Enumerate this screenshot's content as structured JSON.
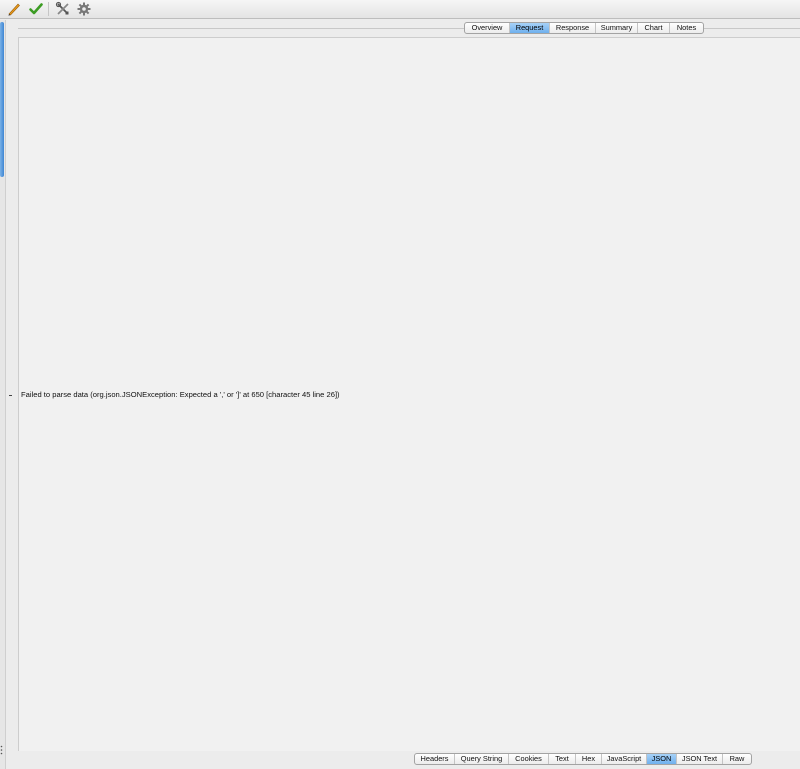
{
  "toolbar": {
    "buttons": [
      {
        "name": "pencil-icon",
        "color": "#e89a1c"
      },
      {
        "name": "checkmark-icon",
        "color": "#3c9c23"
      },
      {
        "name": "tools-icon",
        "color": "#555555"
      },
      {
        "name": "gear-icon",
        "color": "#777777"
      }
    ]
  },
  "top_tabs": {
    "items": [
      "Overview",
      "Request",
      "Response",
      "Summary",
      "Chart",
      "Notes"
    ],
    "active": "Request"
  },
  "body": {
    "error_message": "Failed to parse data (org.json.JSONException: Expected a ',' or ']' at 650 [character 45 line 26])"
  },
  "bottom_tabs": {
    "items": [
      "Headers",
      "Query String",
      "Cookies",
      "Text",
      "Hex",
      "JavaScript",
      "JSON",
      "JSON Text",
      "Raw"
    ],
    "active": "JSON"
  },
  "colors": {
    "active_tab": "#7ab8f0",
    "panel_bg": "#f1f1f1",
    "scroll_thumb": "#4f93d8"
  }
}
